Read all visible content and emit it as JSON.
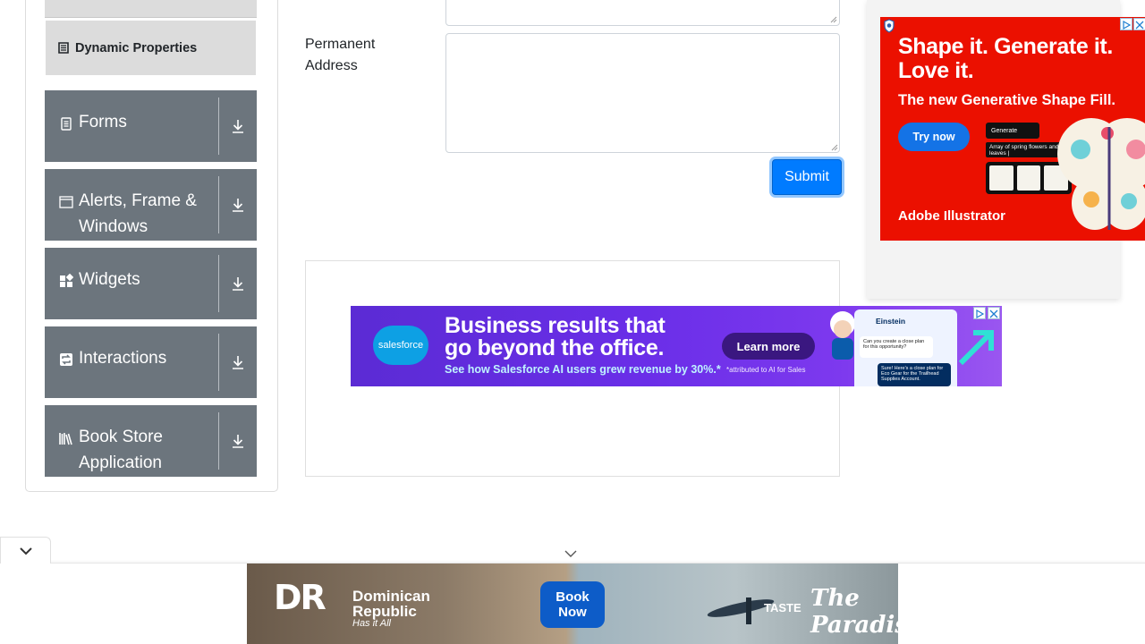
{
  "sidebar": {
    "active_item": {
      "label": "Dynamic Properties",
      "icon": "element-list-icon"
    },
    "groups": [
      {
        "label": "Forms",
        "icon": "form-icon",
        "action_icon": "download-arrow-icon"
      },
      {
        "label": "Alerts, Frame & Windows",
        "icon": "window-icon",
        "action_icon": "download-arrow-icon"
      },
      {
        "label": "Widgets",
        "icon": "widgets-icon",
        "action_icon": "download-arrow-icon"
      },
      {
        "label": "Interactions",
        "icon": "interactions-icon",
        "action_icon": "download-arrow-icon"
      },
      {
        "label": "Book Store Application",
        "icon": "book-store-icon",
        "action_icon": "download-arrow-icon"
      }
    ]
  },
  "form": {
    "permanent_address_label": "Permanent Address",
    "permanent_address_value": "",
    "submit_label": "Submit"
  },
  "ads": {
    "adobe": {
      "headline": "Shape it. Generate it. Love it.",
      "subhead": "The new Generative Shape Fill.",
      "cta": "Try now",
      "generate_chip": "Generate",
      "prompt_text": "Array of spring flowers and leaves |",
      "brand": "Adobe Illustrator"
    },
    "salesforce": {
      "logo": "salesforce",
      "headline_1": "Business results that",
      "headline_2": "go beyond the office.",
      "subline": "See how Salesforce AI users grew revenue by 30%.*",
      "cta": "Learn more",
      "footnote": "*attributed to AI for Sales",
      "chat_title": "Einstein",
      "chat_q": "Can you create a close plan for this opportunity?",
      "chat_a": "Sure! Here's a close plan for Eco Gear for the Trailhead Supplies Account."
    },
    "dominican": {
      "logo": "DR",
      "name": "Dominican Republic",
      "tagline": "Has it All",
      "cta": "Book Now",
      "taste": "TASTE",
      "paradise": "The Paradise"
    }
  },
  "colors": {
    "sidebar_group_bg": "#6c757d",
    "sidebar_active_bg": "#dcdcdc",
    "primary": "#007bff",
    "adobe_red": "#eb1000",
    "salesforce_purple": "#5b2bd4"
  }
}
